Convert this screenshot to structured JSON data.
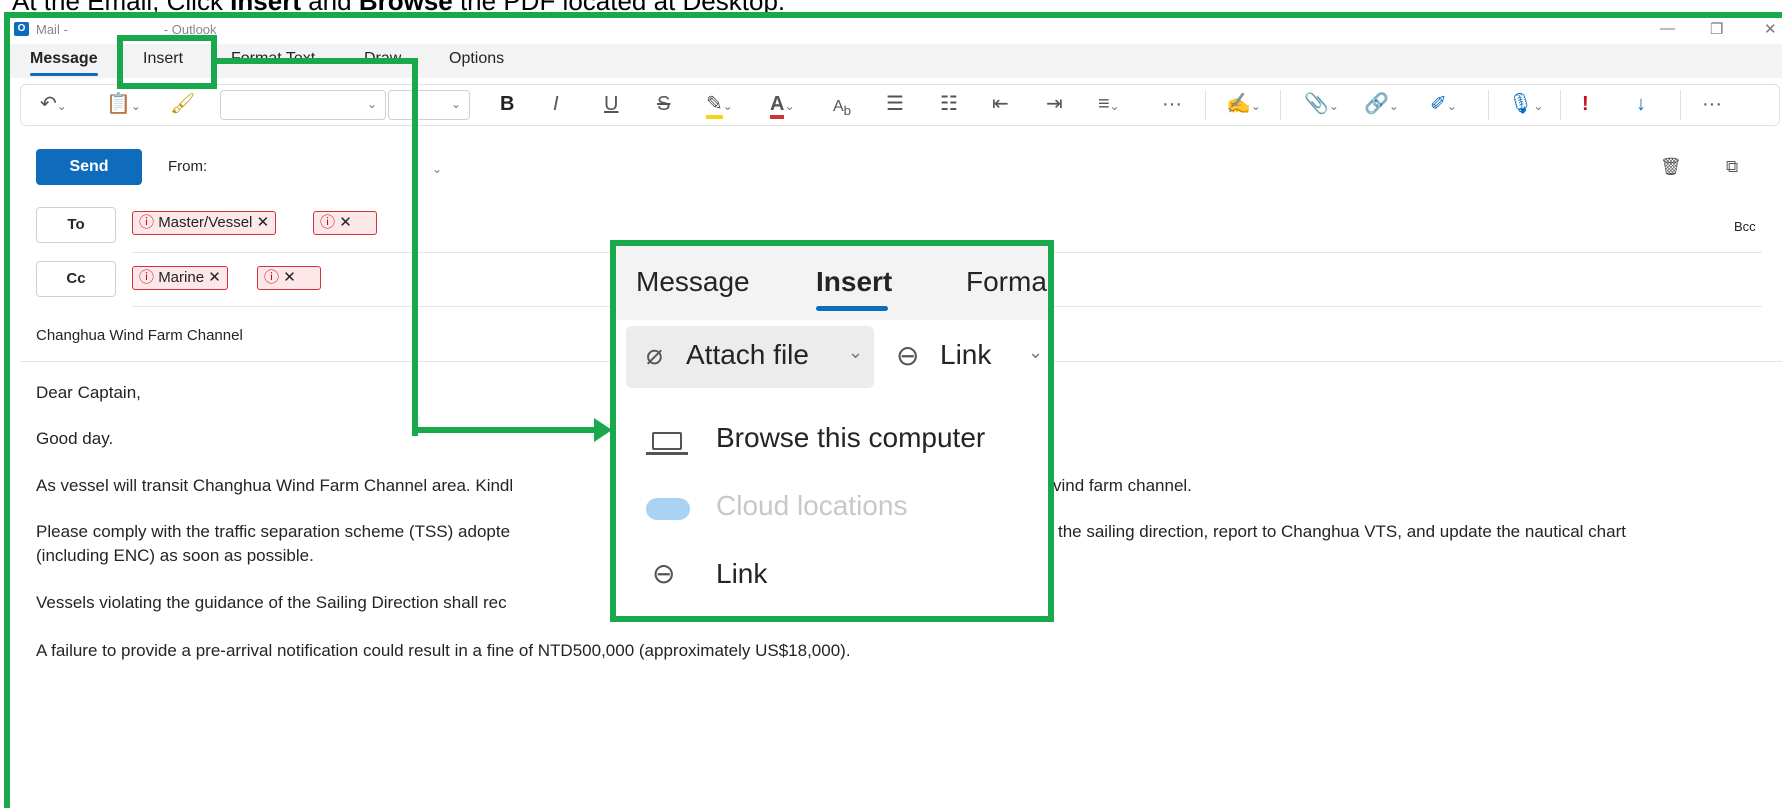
{
  "instruction": {
    "prefix": "At the Email, Click ",
    "bold1": "Insert",
    "mid": " and ",
    "bold2": "Browse",
    "suffix": " the PDF located at Desktop."
  },
  "window": {
    "app_label": "Mail -",
    "title_suffix": "- Outlook",
    "min_glyph": "—",
    "restore_glyph": "❐",
    "close_glyph": "✕"
  },
  "tabs": [
    {
      "label": "Message"
    },
    {
      "label": "Insert"
    },
    {
      "label": "Format Text"
    },
    {
      "label": "Draw"
    },
    {
      "label": "Options"
    }
  ],
  "ribbon": {
    "bold": "B",
    "italic": "I",
    "underline": "U",
    "strike": "S",
    "more": "···",
    "more2": "···"
  },
  "compose": {
    "send_label": "Send",
    "from_label": "From:",
    "to_label": "To",
    "cc_label": "Cc",
    "bcc_label": "Bcc",
    "to_recipients": [
      {
        "name": "Master/Vessel"
      },
      {
        "name": ""
      }
    ],
    "cc_recipients": [
      {
        "name": "Marine"
      },
      {
        "name": ""
      }
    ],
    "subject": "Changhua Wind Farm Channel",
    "body": [
      "Dear Captain,",
      "Good day.",
      "As vessel will transit Changhua Wind Farm Channel area. Kindl",
      "vind farm channel.",
      "Please comply with the traffic separation scheme (TSS) adopte",
      "the sailing direction, report to Changhua VTS, and update the nautical chart",
      "(including ENC) as soon as possible.",
      "Vessels violating the guidance of the Sailing Direction shall rec",
      "A failure to provide a pre-arrival notification could result in a fine of NTD500,000 (approximately US$18,000)."
    ]
  },
  "popup": {
    "tabs": [
      {
        "label": "Message"
      },
      {
        "label": "Insert"
      },
      {
        "label": "Forma"
      }
    ],
    "attach_label": "Attach file",
    "link_label": "Link",
    "menu": [
      {
        "label": "Browse this computer",
        "icon": "laptop-icon",
        "enabled": true
      },
      {
        "label": "Cloud locations",
        "icon": "cloud-icon",
        "enabled": false
      },
      {
        "label": "Link",
        "icon": "link-icon",
        "enabled": true
      }
    ]
  },
  "colors": {
    "highlight": "#1aa84c",
    "accent": "#0f6cbd",
    "chip_bg": "#fde7e9",
    "chip_border": "#d13438"
  }
}
